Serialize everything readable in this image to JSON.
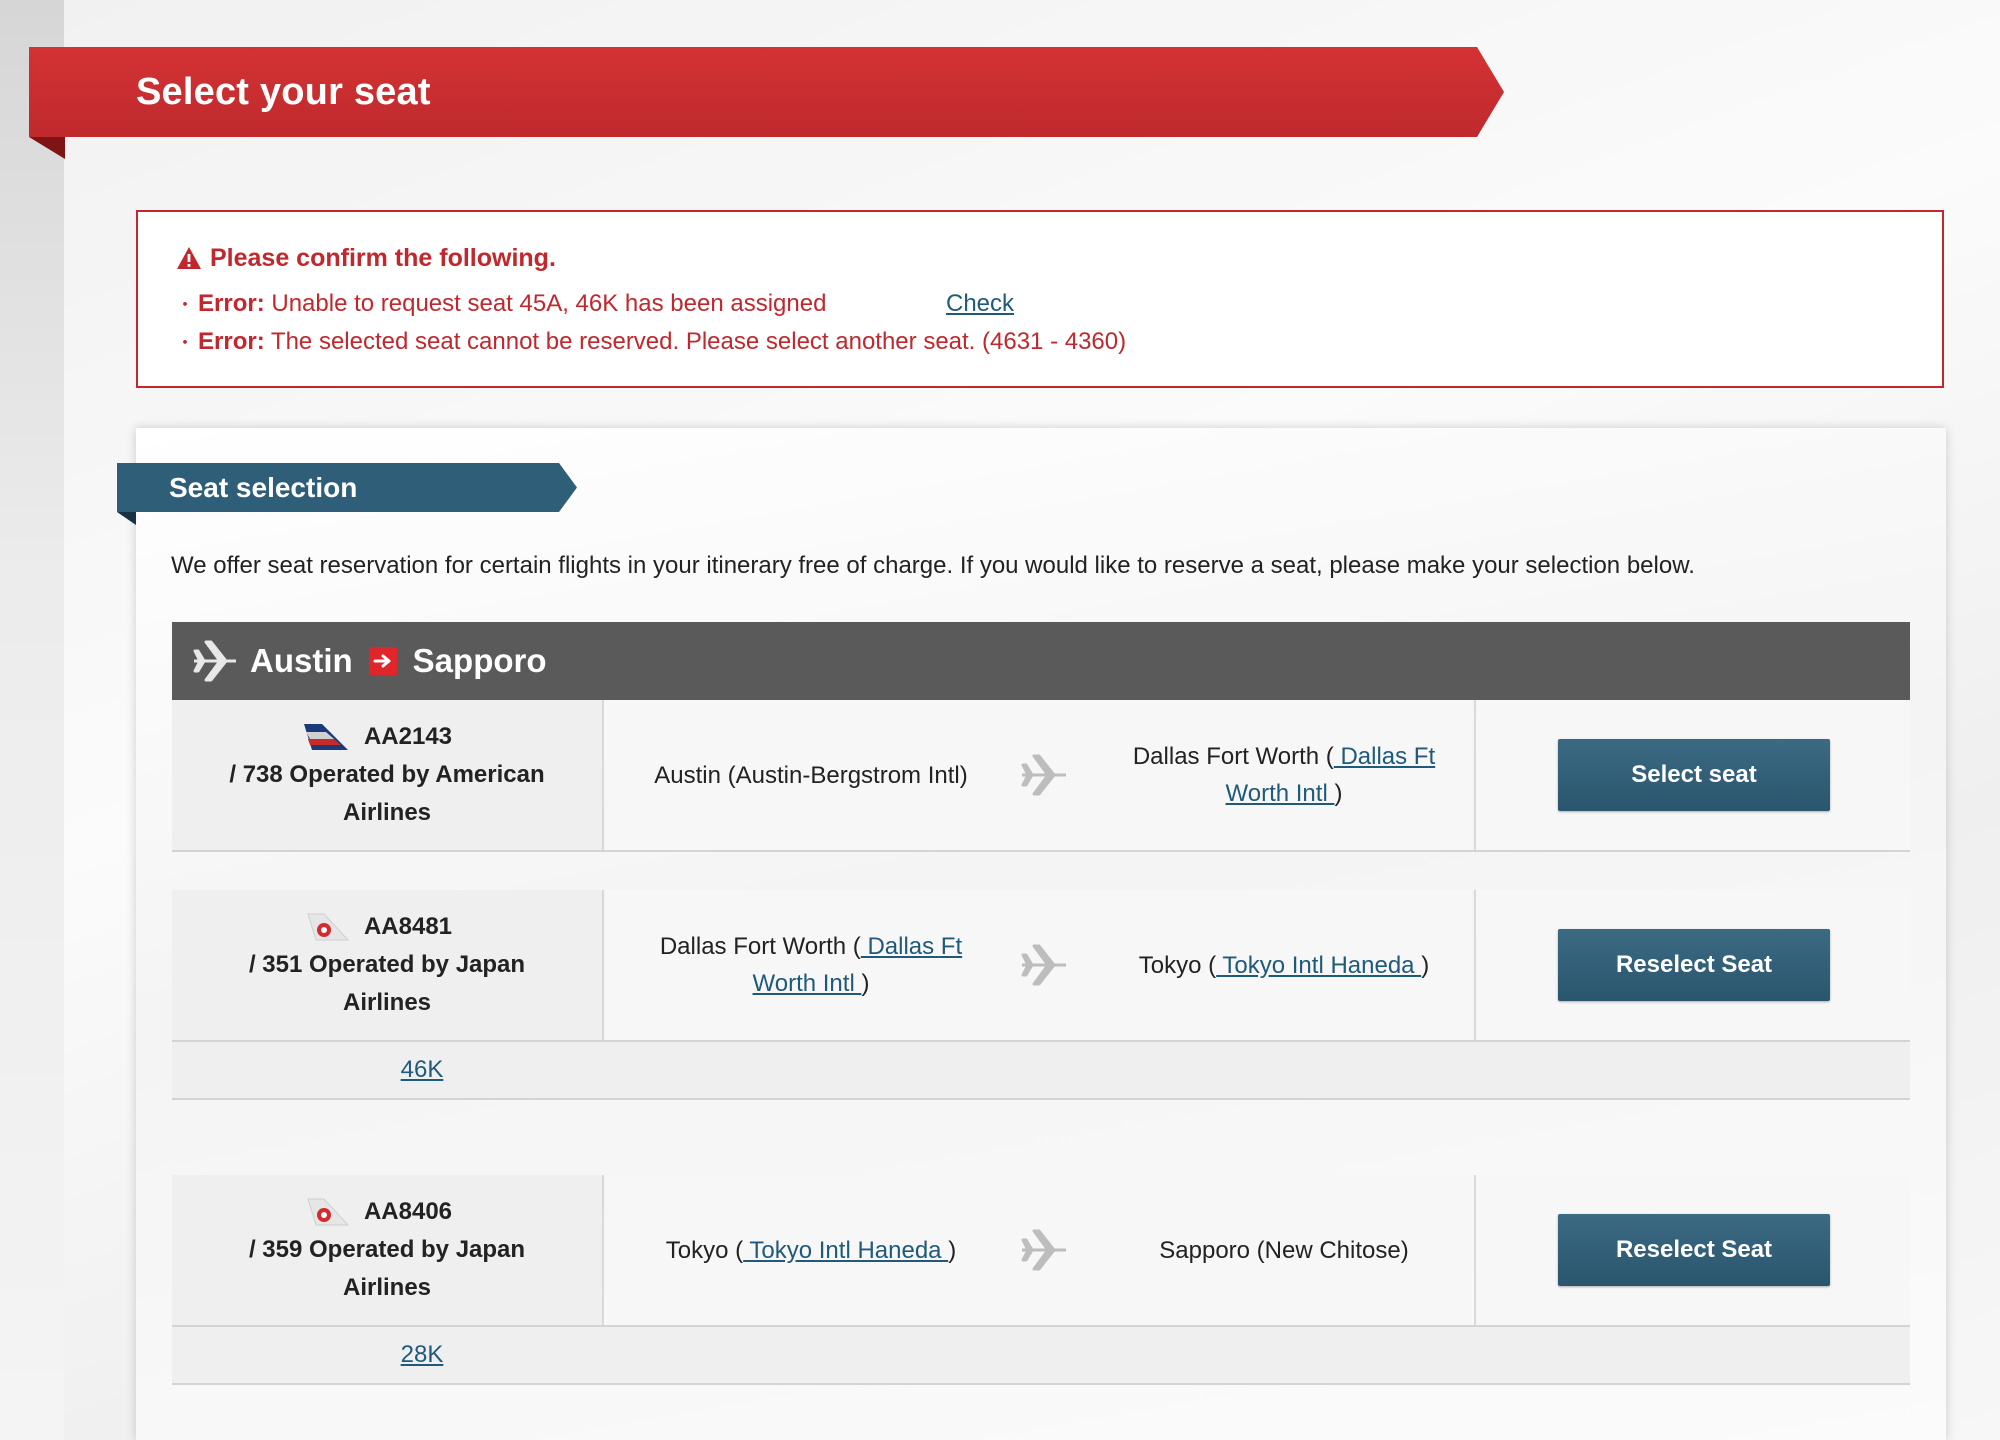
{
  "header": {
    "title": "Select your seat"
  },
  "errors": {
    "heading": "Please confirm the following.",
    "items": [
      {
        "label": "Error:",
        "message": "Unable to request seat 45A, 46K has been assigned"
      },
      {
        "label": "Error:",
        "message": "The selected seat cannot be reserved. Please select another seat. (4631 - 4360)"
      }
    ],
    "check_link": "Check",
    "color": "#c1272d"
  },
  "section": {
    "title": "Seat selection",
    "intro": "We offer seat reservation for certain flights in your itinerary free of charge. If you would like to reserve a seat, please make your selection below."
  },
  "route": {
    "from": "Austin",
    "to": "Sapporo"
  },
  "flights": [
    {
      "airline_logo": "american-airlines-tail-icon",
      "flight_no": "AA2143",
      "operated_line1": "/ 738 Operated by American",
      "operated_line2": "Airlines",
      "from_city": "Austin (Austin-Bergstrom Intl)",
      "to_city": "Dallas Fort Worth (",
      "to_airport_line1": " Dallas Ft",
      "to_airport_line2": "Worth Intl ",
      "to_close": ")",
      "button": "Select seat"
    },
    {
      "airline_logo": "japan-airlines-tail-icon",
      "flight_no": "AA8481",
      "operated_line1": "/ 351 Operated by Japan",
      "operated_line2": "Airlines",
      "from_city": "Dallas Fort Worth (",
      "from_airport_line1": " Dallas Ft",
      "from_airport_line2": "Worth Intl ",
      "from_close": ")",
      "to_city": "Tokyo (",
      "to_airport": " Tokyo Intl Haneda ",
      "to_close": ")",
      "button": "Reselect Seat",
      "seat": "46K"
    },
    {
      "airline_logo": "japan-airlines-tail-icon",
      "flight_no": "AA8406",
      "operated_line1": "/ 359 Operated by Japan",
      "operated_line2": "Airlines",
      "from_city": "Tokyo (",
      "from_airport": " Tokyo Intl Haneda ",
      "from_close": ")",
      "to_city": "Sapporo (New Chitose)",
      "button": "Reselect Seat",
      "seat": "28K"
    }
  ],
  "colors": {
    "brand_red": "#c8292d",
    "button_blue": "#2f5f78",
    "link_blue": "#1f5a7a",
    "route_bar": "#5a5a5a"
  }
}
